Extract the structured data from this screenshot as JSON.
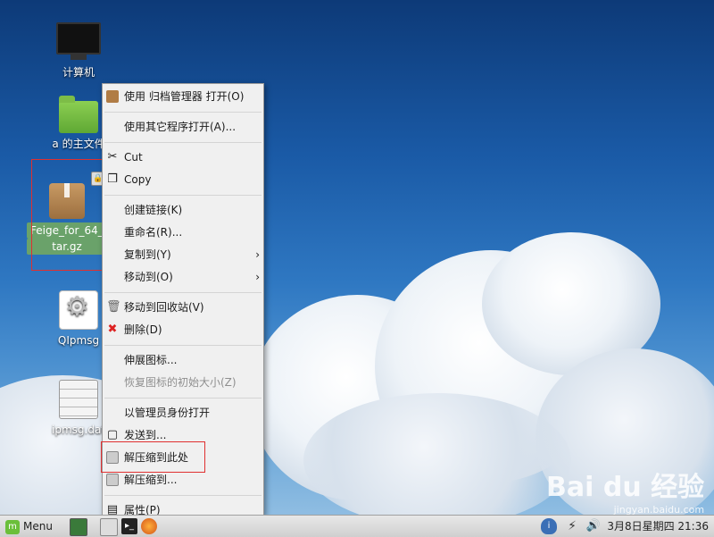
{
  "desktop": {
    "icons": [
      {
        "name": "computer",
        "label": "计算机"
      },
      {
        "name": "home",
        "label": "a 的主文件"
      },
      {
        "name": "archive",
        "label_line1": "Feige_for_64_l",
        "label_line2": "tar.gz"
      },
      {
        "name": "qipmsg",
        "label": "QIpmsg"
      },
      {
        "name": "ipmsg-file",
        "label": "ipmsg.dat"
      }
    ]
  },
  "context_menu": {
    "items": [
      {
        "label": "使用 归档管理器 打开(O)",
        "icon": "archive-manager-icon"
      },
      {
        "label": "使用其它程序打开(A)..."
      },
      {
        "label": "Cut",
        "icon": "scissors-icon"
      },
      {
        "label": "Copy",
        "icon": "copy-icon"
      },
      {
        "label": "创建链接(K)"
      },
      {
        "label": "重命名(R)..."
      },
      {
        "label": "复制到(Y)"
      },
      {
        "label": "移动到(O)"
      },
      {
        "label": "移动到回收站(V)",
        "icon": "trash-icon"
      },
      {
        "label": "删除(D)",
        "icon": "delete-icon"
      },
      {
        "label": "伸展图标..."
      },
      {
        "label": "恢复图标的初始大小(Z)"
      },
      {
        "label": "以管理员身份打开"
      },
      {
        "label": "发送到...",
        "icon": "send-icon"
      },
      {
        "label": "解压缩到此处",
        "icon": "extract-icon"
      },
      {
        "label": "解压缩到...",
        "icon": "extract-icon"
      },
      {
        "label": "属性(P)",
        "icon": "properties-icon"
      }
    ],
    "submenu_arrow": "›"
  },
  "taskbar": {
    "menu_label": "Menu",
    "clock": "3月8日星期四 21:36"
  },
  "watermark": {
    "brand": "Bai du 经验",
    "url": "jingyan.baidu.com"
  }
}
